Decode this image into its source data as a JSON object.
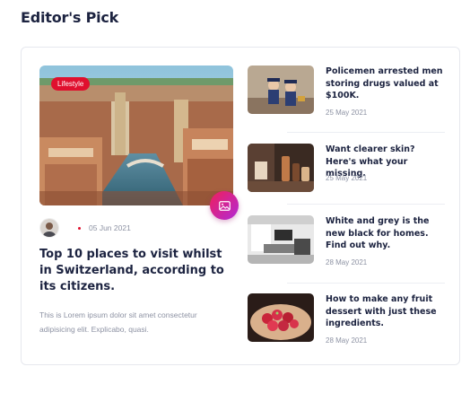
{
  "section": {
    "title": "Editor's Pick"
  },
  "featured": {
    "category": "Lifestyle",
    "date": "05 Jun 2021",
    "title": "Top 10 places to visit whilst in Switzerland, according to its citizens.",
    "excerpt": "This is Lorem ipsum dolor sit amet consectetur adipisicing elit. Explicabo, quasi.",
    "media_icon": "image-icon"
  },
  "articles": [
    {
      "title": "Policemen arrested men storing drugs valued at $100K.",
      "date": "25 May 2021"
    },
    {
      "title": "Want clearer skin? Here's what your missing.",
      "date": "25 May 2021"
    },
    {
      "title": "White and grey is the new black for homes. Find out why.",
      "date": "28 May 2021"
    },
    {
      "title": "How to make any fruit dessert with just these ingredients.",
      "date": "28 May 2021"
    }
  ],
  "colors": {
    "accent": "#e0102e",
    "heading": "#1c2340",
    "muted": "#8d92a3"
  }
}
